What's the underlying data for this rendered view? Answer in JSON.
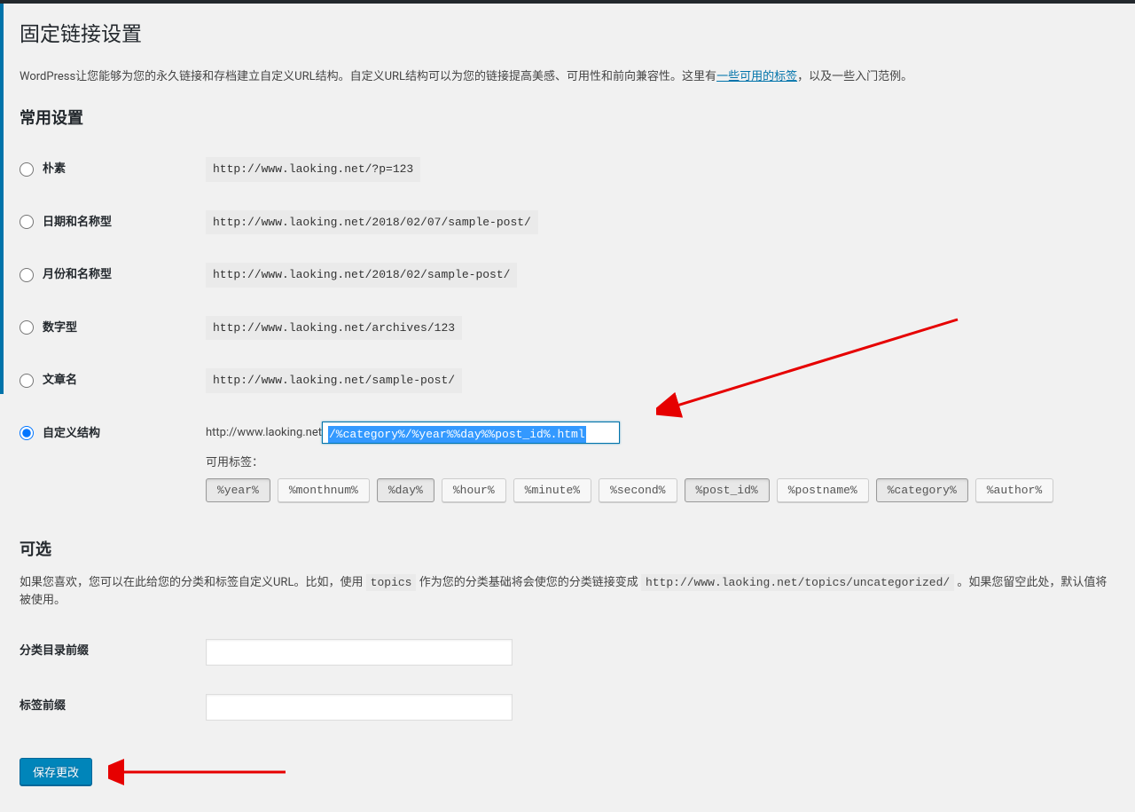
{
  "page": {
    "title": "固定链接设置",
    "intro_pre": "WordPress让您能够为您的永久链接和存档建立自定义URL结构。自定义URL结构可以为您的链接提高美感、可用性和前向兼容性。这里有",
    "intro_link": "一些可用的标签",
    "intro_post": "，以及一些入门范例。"
  },
  "common": {
    "heading": "常用设置",
    "options": [
      {
        "label": "朴素",
        "sample": "http://www.laoking.net/?p=123",
        "checked": false
      },
      {
        "label": "日期和名称型",
        "sample": "http://www.laoking.net/2018/02/07/sample-post/",
        "checked": false
      },
      {
        "label": "月份和名称型",
        "sample": "http://www.laoking.net/2018/02/sample-post/",
        "checked": false
      },
      {
        "label": "数字型",
        "sample": "http://www.laoking.net/archives/123",
        "checked": false
      },
      {
        "label": "文章名",
        "sample": "http://www.laoking.net/sample-post/",
        "checked": false
      }
    ],
    "custom": {
      "label": "自定义结构",
      "site_url": "http://www.laoking.net",
      "value": "/%category%/%year%%day%%post_id%.html",
      "checked": true,
      "tags_label": "可用标签：",
      "tags": [
        {
          "t": "%year%",
          "sel": true
        },
        {
          "t": "%monthnum%",
          "sel": false
        },
        {
          "t": "%day%",
          "sel": true
        },
        {
          "t": "%hour%",
          "sel": false
        },
        {
          "t": "%minute%",
          "sel": false
        },
        {
          "t": "%second%",
          "sel": false
        },
        {
          "t": "%post_id%",
          "sel": true
        },
        {
          "t": "%postname%",
          "sel": false
        },
        {
          "t": "%category%",
          "sel": true
        },
        {
          "t": "%author%",
          "sel": false
        }
      ]
    }
  },
  "optional": {
    "heading": "可选",
    "desc_pre": "如果您喜欢，您可以在此给您的分类和标签自定义URL。比如，使用 ",
    "desc_code1": "topics",
    "desc_mid": " 作为您的分类基础将会使您的分类链接变成 ",
    "desc_code2": "http://www.laoking.net/topics/uncategorized/",
    "desc_post": " 。如果您留空此处，默认值将被使用。",
    "category_label": "分类目录前缀",
    "tag_label": "标签前缀"
  },
  "submit": {
    "label": "保存更改"
  }
}
